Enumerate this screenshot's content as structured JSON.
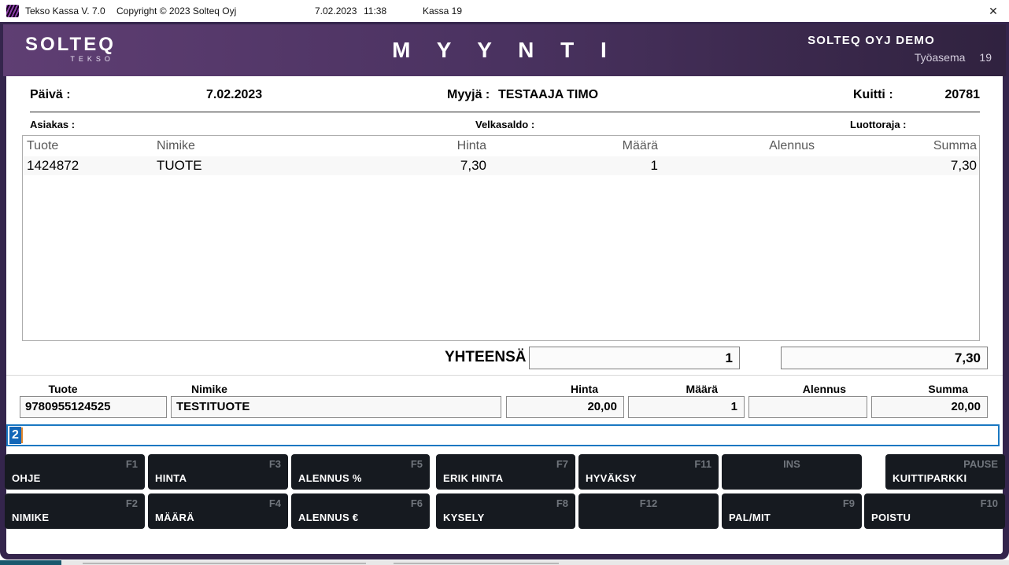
{
  "titlebar": {
    "title": "Tekso Kassa V. 7.0",
    "copyright": "Copyright © 2023 Solteq Oyj",
    "date": "7.02.2023",
    "time": "11:38",
    "register": "Kassa 19",
    "close": "✕"
  },
  "header": {
    "logo_main": "SOLTEQ",
    "logo_sub": "TEKSO",
    "title": "M Y Y N T I",
    "company": "SOLTEQ OYJ DEMO",
    "workstation_label": "Työasema",
    "workstation_value": "19"
  },
  "info": {
    "date_label": "Päivä :",
    "date_value": "7.02.2023",
    "seller_label": "Myyjä :",
    "seller_value": "TESTAAJA TIMO",
    "receipt_label": "Kuitti :",
    "receipt_value": "20781",
    "customer_label": "Asiakas :",
    "debt_label": "Velkasaldo :",
    "credit_label": "Luottoraja :"
  },
  "table": {
    "columns": [
      "Tuote",
      "Nimike",
      "Hinta",
      "Määrä",
      "Alennus",
      "Summa"
    ],
    "rows": [
      [
        "1424872",
        "TUOTE",
        "7,30",
        "1",
        "",
        "7,30"
      ]
    ]
  },
  "totals": {
    "label": "YHTEENSÄ",
    "quantity": "1",
    "sum": "7,30"
  },
  "entry": {
    "labels": {
      "product": "Tuote",
      "name": "Nimike",
      "price": "Hinta",
      "quantity": "Määrä",
      "discount": "Alennus",
      "sum": "Summa"
    },
    "product": "9780955124525",
    "name": "TESTITUOTE",
    "price": "20,00",
    "quantity": "1",
    "discount": "",
    "sum": "20,00"
  },
  "command_input": {
    "value": "2"
  },
  "keys": {
    "row1": [
      {
        "label": "OHJE",
        "key": "F1"
      },
      {
        "label": "HINTA",
        "key": "F3"
      },
      {
        "label": "ALENNUS %",
        "key": "F5"
      },
      {
        "label": "ERIK HINTA",
        "key": "F7"
      },
      {
        "label": "HYVÄKSY",
        "key": "F11"
      },
      {
        "label": "",
        "key": "INS"
      },
      {
        "label": "KUITTIPARKKI",
        "key": "PAUSE"
      }
    ],
    "row2": [
      {
        "label": "NIMIKE",
        "key": "F2"
      },
      {
        "label": "MÄÄRÄ",
        "key": "F4"
      },
      {
        "label": "ALENNUS €",
        "key": "F6"
      },
      {
        "label": "KYSELY",
        "key": "F8"
      },
      {
        "label": "",
        "key": "F12"
      },
      {
        "label": "PAL/MIT",
        "key": "F9"
      },
      {
        "label": "POISTU",
        "key": "F10"
      }
    ]
  },
  "colors": {
    "header_purple_left": "#5f3e73",
    "header_purple_right": "#30223f",
    "frame_purple": "#34254c",
    "button_dark": "#161a20",
    "selection_blue": "#1266b8",
    "caret_orange": "#e0872e",
    "input_border_blue": "#1a78c2",
    "taskbar_teal": "#19586d"
  }
}
